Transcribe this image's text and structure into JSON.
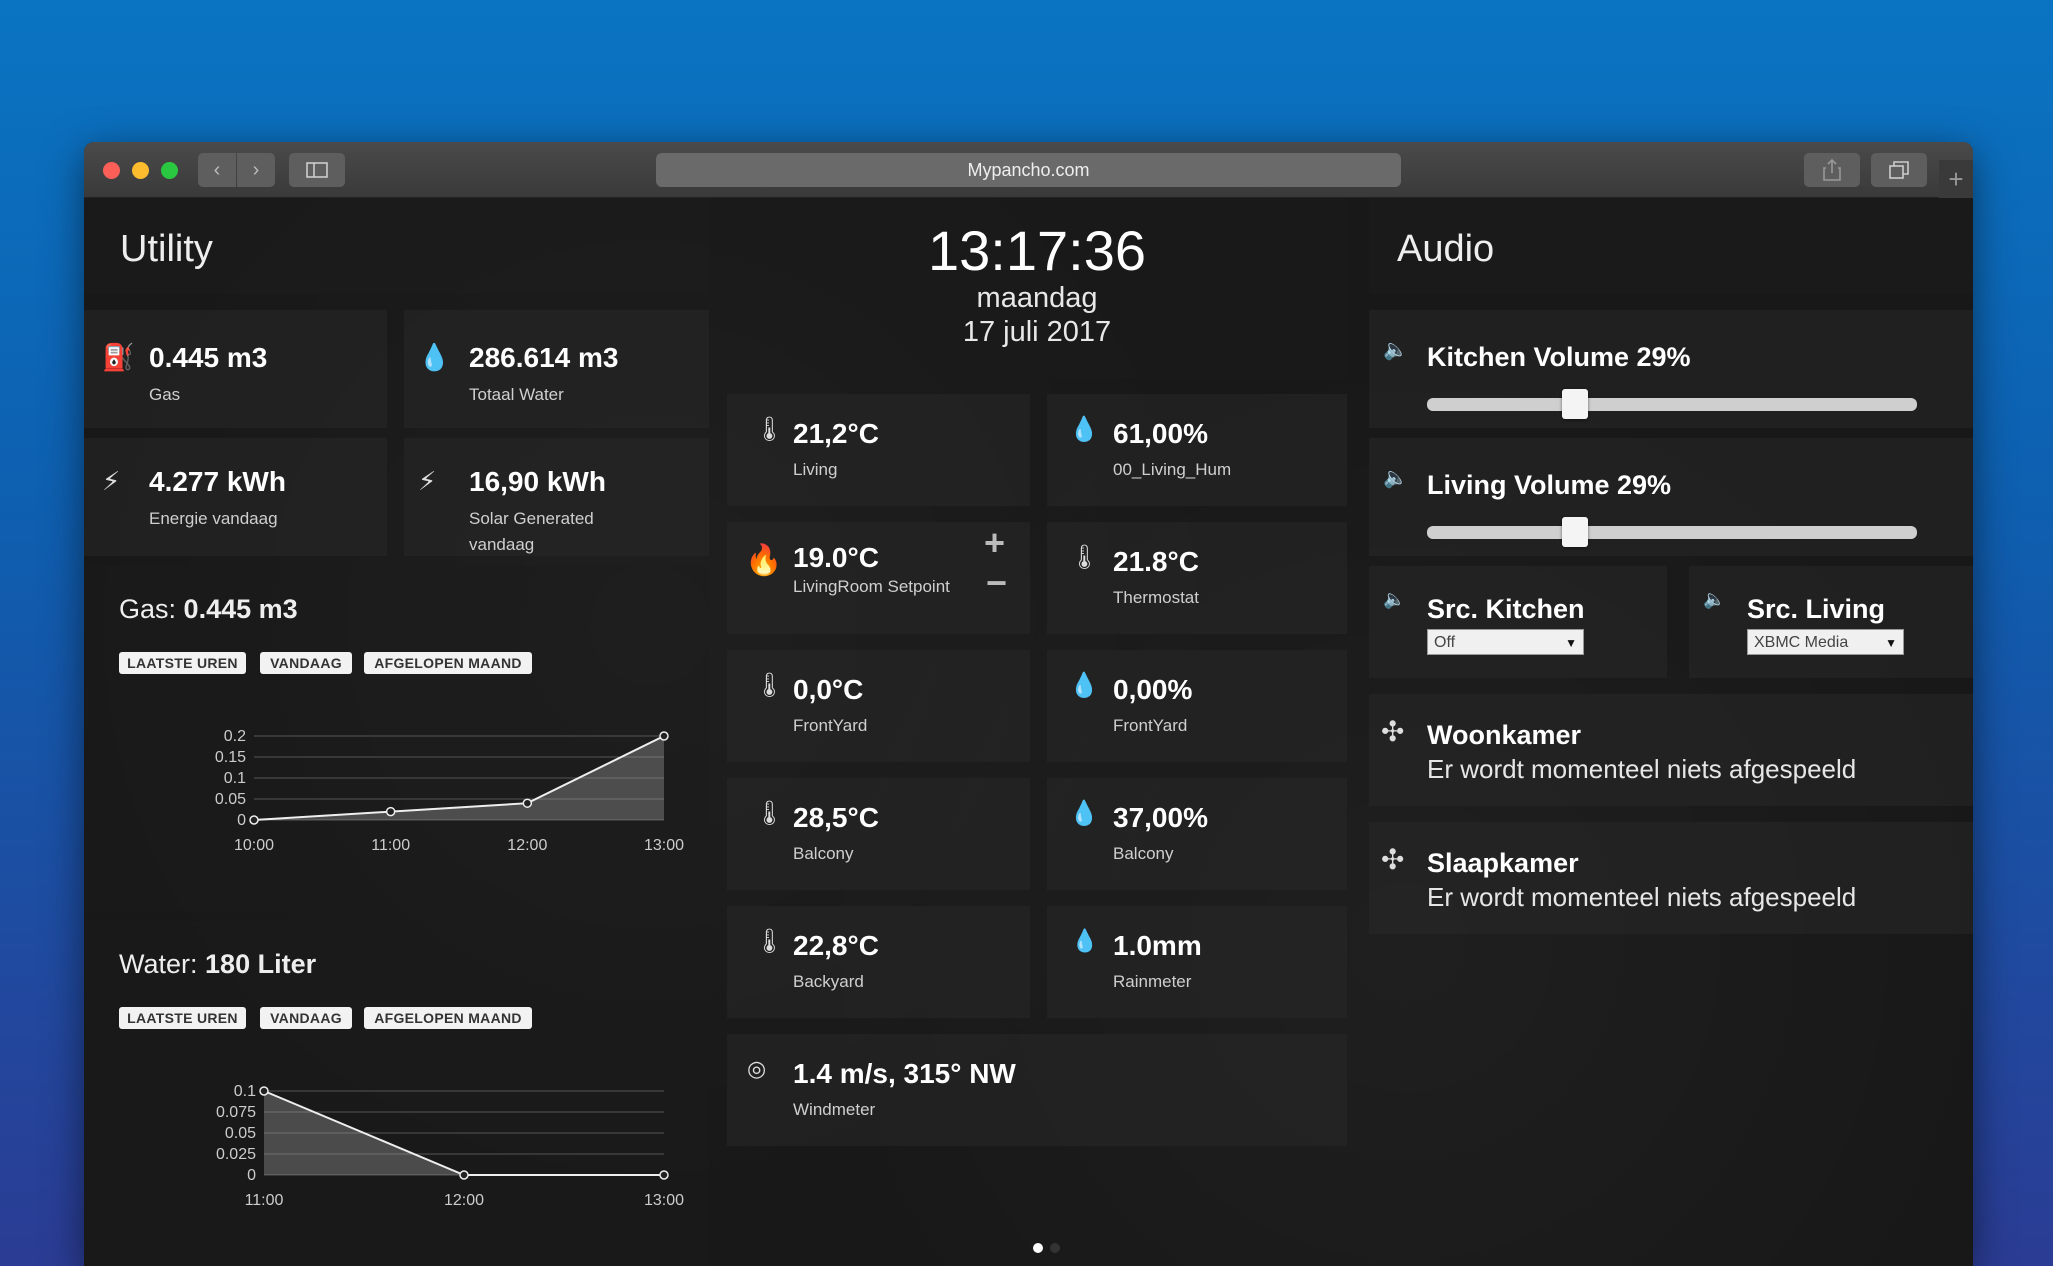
{
  "browser": {
    "url": "Mypancho.com"
  },
  "utility": {
    "title": "Utility",
    "stats": [
      {
        "value": "0.445 m3",
        "label": "Gas",
        "icon": "gas-icon"
      },
      {
        "value": "286.614 m3",
        "label": "Totaal Water",
        "icon": "water-drop-icon"
      },
      {
        "value": "4.277 kWh",
        "label": "Energie vandaag",
        "icon": "plug-icon"
      },
      {
        "value": "16,90 kWh",
        "label": "Solar Generated",
        "label2": "vandaag",
        "icon": "plug-icon"
      }
    ],
    "gas_chart": {
      "title_prefix": "Gas:",
      "title_value": "0.445 m3",
      "buttons": [
        "LAATSTE UREN",
        "VANDAAG",
        "AFGELOPEN MAAND"
      ]
    },
    "water_chart": {
      "title_prefix": "Water:",
      "title_value": "180 Liter",
      "buttons": [
        "LAATSTE UREN",
        "VANDAAG",
        "AFGELOPEN MAAND"
      ]
    }
  },
  "chart_data": [
    {
      "type": "area",
      "x": [
        "10:00",
        "11:00",
        "12:00",
        "13:00"
      ],
      "values": [
        0,
        0.02,
        0.04,
        0.2
      ],
      "yticks": [
        "0.2",
        "0.15",
        "0.1",
        "0.05",
        "0"
      ],
      "ylim": [
        0,
        0.2
      ],
      "grid": true
    },
    {
      "type": "area",
      "x": [
        "11:00",
        "12:00",
        "13:00"
      ],
      "values": [
        0.1,
        0,
        0
      ],
      "yticks": [
        "0.1",
        "0.075",
        "0.05",
        "0.025",
        "0"
      ],
      "ylim": [
        0,
        0.1
      ],
      "grid": true
    }
  ],
  "clock": {
    "time": "13:17:36",
    "day": "maandag",
    "date": "17 juli 2017"
  },
  "sensors": [
    {
      "value": "21,2°C",
      "label": "Living",
      "icon": "thermometer-icon"
    },
    {
      "value": "61,00%",
      "label": "00_Living_Hum",
      "icon": "humidity-icon"
    },
    {
      "value": "19.0°C",
      "label": "LivingRoom Setpoint",
      "icon": "flame-icon"
    },
    {
      "value": "21.8°C",
      "label": "Thermostat",
      "icon": "thermometer-icon"
    },
    {
      "value": "0,0°C",
      "label": "FrontYard",
      "icon": "thermometer-icon"
    },
    {
      "value": "0,00%",
      "label": "FrontYard",
      "icon": "humidity-icon"
    },
    {
      "value": "28,5°C",
      "label": "Balcony",
      "icon": "thermometer-icon"
    },
    {
      "value": "37,00%",
      "label": "Balcony",
      "icon": "humidity-icon"
    },
    {
      "value": "22,8°C",
      "label": "Backyard",
      "icon": "thermometer-icon"
    },
    {
      "value": "1.0mm",
      "label": "Rainmeter",
      "icon": "rain-icon"
    },
    {
      "value": "1.4 m/s, 315° NW",
      "label": "Windmeter",
      "icon": "wind-icon"
    }
  ],
  "audio": {
    "title": "Audio",
    "kitchen_volume": {
      "label": "Kitchen Volume 29%",
      "level": 0.29
    },
    "living_volume": {
      "label": "Living Volume 29%",
      "level": 0.29
    },
    "src_kitchen": {
      "label": "Src. Kitchen",
      "selected": "Off"
    },
    "src_living": {
      "label": "Src. Living",
      "selected": "XBMC Media"
    },
    "players": [
      {
        "name": "Woonkamer",
        "status": "Er wordt momenteel niets afgespeeld"
      },
      {
        "name": "Slaapkamer",
        "status": "Er wordt momenteel niets afgespeeld"
      }
    ]
  },
  "pager": {
    "pages": 2,
    "active": 0
  }
}
